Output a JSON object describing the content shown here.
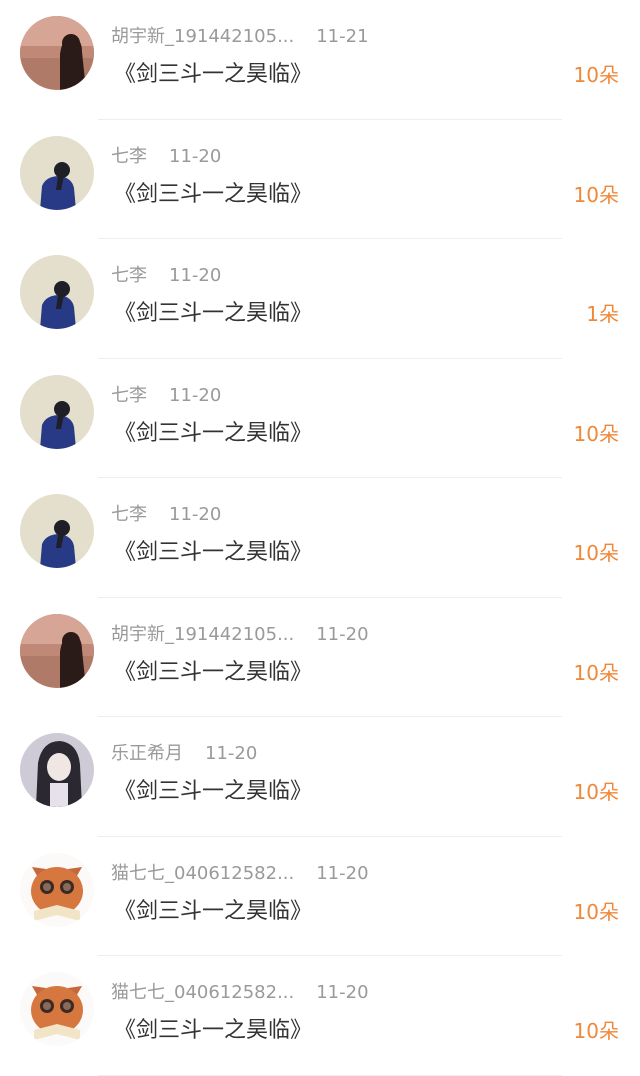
{
  "gifts": [
    {
      "name": "胡宇新_191442105...",
      "date": "11-21",
      "title": "《剑三斗一之昊临》",
      "count": "10朵",
      "avatar": "sunset-girl"
    },
    {
      "name": "七李",
      "date": "11-20",
      "title": "《剑三斗一之昊临》",
      "count": "10朵",
      "avatar": "blue-figure"
    },
    {
      "name": "七李",
      "date": "11-20",
      "title": "《剑三斗一之昊临》",
      "count": "1朵",
      "avatar": "blue-figure"
    },
    {
      "name": "七李",
      "date": "11-20",
      "title": "《剑三斗一之昊临》",
      "count": "10朵",
      "avatar": "blue-figure"
    },
    {
      "name": "七李",
      "date": "11-20",
      "title": "《剑三斗一之昊临》",
      "count": "10朵",
      "avatar": "blue-figure"
    },
    {
      "name": "胡宇新_191442105...",
      "date": "11-20",
      "title": "《剑三斗一之昊临》",
      "count": "10朵",
      "avatar": "sunset-girl"
    },
    {
      "name": "乐正希月",
      "date": "11-20",
      "title": "《剑三斗一之昊临》",
      "count": "10朵",
      "avatar": "anime-girl"
    },
    {
      "name": "猫七七_040612582...",
      "date": "11-20",
      "title": "《剑三斗一之昊临》",
      "count": "10朵",
      "avatar": "cat-reading"
    },
    {
      "name": "猫七七_040612582...",
      "date": "11-20",
      "title": "《剑三斗一之昊临》",
      "count": "10朵",
      "avatar": "cat-reading"
    }
  ],
  "colors": {
    "count": "#f0883a",
    "meta": "#9a9a9a",
    "title": "#333333"
  }
}
